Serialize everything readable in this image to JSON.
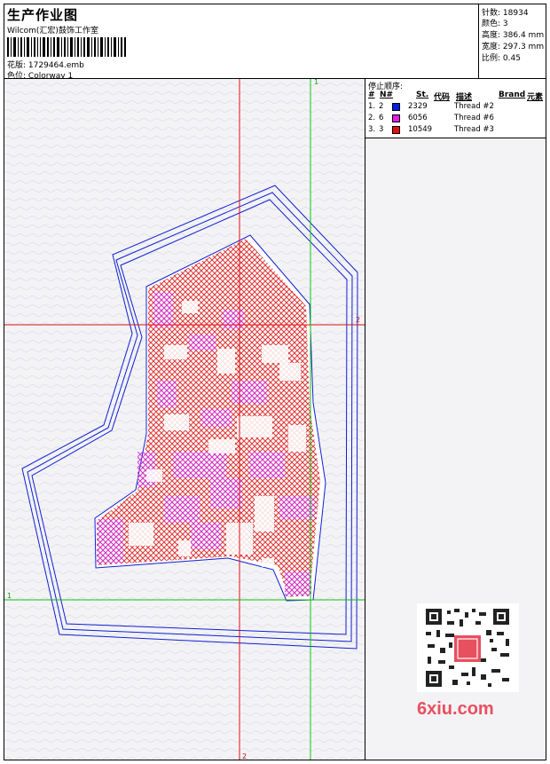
{
  "header": {
    "title": "生产作业图",
    "company": "Wilcom(汇宏)鼓饰工作室",
    "design_label": "花版:",
    "design_value": "1729464.emb",
    "colorway_label": "色位:",
    "colorway_value": "Colorway 1"
  },
  "stats": {
    "stitches_label": "针数:",
    "stitches_value": "18934",
    "colors_label": "颜色:",
    "colors_value": "3",
    "height_label": "高度:",
    "height_value": "386.4 mm",
    "width_label": "宽度:",
    "width_value": "297.3 mm",
    "scale_label": "比例:",
    "scale_value": "0.45"
  },
  "stop_sequence": {
    "title": "停止顺序:",
    "col_hash": "#",
    "col_n": "N#",
    "col_st": "St.",
    "col_code": "代码",
    "col_desc": "描述",
    "col_brand": "Brand",
    "col_element": "元素",
    "rows": [
      {
        "idx": "1.",
        "n": "2",
        "code": "2329",
        "desc": "Thread #2",
        "color": "#0020e0"
      },
      {
        "idx": "2.",
        "n": "6",
        "code": "6056",
        "desc": "Thread #6",
        "color": "#e020e0"
      },
      {
        "idx": "3.",
        "n": "3",
        "code": "10549",
        "desc": "Thread #3",
        "color": "#e01010"
      }
    ]
  },
  "axes": {
    "green_top": "1",
    "green_left": "1",
    "red_right": "2",
    "red_bottom": "2"
  },
  "watermark": {
    "brand": "6xiu.com"
  }
}
